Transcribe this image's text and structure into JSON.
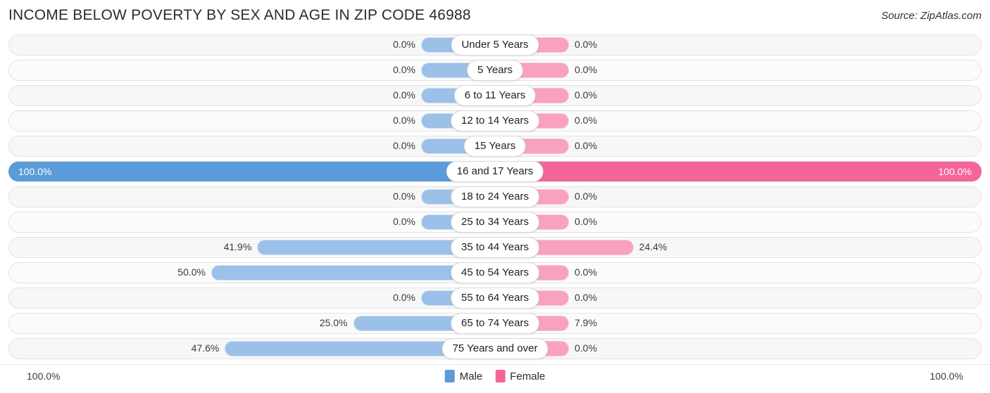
{
  "header": {
    "title": "INCOME BELOW POVERTY BY SEX AND AGE IN ZIP CODE 46988",
    "source": "Source: ZipAtlas.com"
  },
  "footer": {
    "axis_left": "100.0%",
    "axis_right": "100.0%",
    "legend": [
      {
        "label": "Male",
        "color": "#5b9bd9"
      },
      {
        "label": "Female",
        "color": "#f4659a"
      }
    ]
  },
  "colors": {
    "male_light": "#9cc1e8",
    "female_light": "#f9a1c0",
    "male_strong": "#5b9bd9",
    "female_strong": "#f4659a",
    "track": "#f7f7f7"
  },
  "chart_data": {
    "type": "bar",
    "orientation": "horizontal-diverging",
    "title": "INCOME BELOW POVERTY BY SEX AND AGE IN ZIP CODE 46988",
    "xlabel": "",
    "ylabel": "",
    "xlim": [
      0,
      100
    ],
    "units": "%",
    "grid": false,
    "legend_position": "bottom-center",
    "categories": [
      "Under 5 Years",
      "5 Years",
      "6 to 11 Years",
      "12 to 14 Years",
      "15 Years",
      "16 and 17 Years",
      "18 to 24 Years",
      "25 to 34 Years",
      "35 to 44 Years",
      "45 to 54 Years",
      "55 to 64 Years",
      "65 to 74 Years",
      "75 Years and over"
    ],
    "series": [
      {
        "name": "Male",
        "color": "#5b9bd9",
        "values": [
          0.0,
          0.0,
          0.0,
          0.0,
          0.0,
          100.0,
          0.0,
          0.0,
          41.9,
          50.0,
          0.0,
          25.0,
          47.6
        ],
        "labels": [
          "0.0%",
          "0.0%",
          "0.0%",
          "0.0%",
          "0.0%",
          "100.0%",
          "0.0%",
          "0.0%",
          "41.9%",
          "50.0%",
          "0.0%",
          "25.0%",
          "47.6%"
        ]
      },
      {
        "name": "Female",
        "color": "#f4659a",
        "values": [
          0.0,
          0.0,
          0.0,
          0.0,
          0.0,
          100.0,
          0.0,
          0.0,
          24.4,
          0.0,
          0.0,
          7.9,
          0.0
        ],
        "labels": [
          "0.0%",
          "0.0%",
          "0.0%",
          "0.0%",
          "0.0%",
          "100.0%",
          "0.0%",
          "0.0%",
          "24.4%",
          "0.0%",
          "0.0%",
          "7.9%",
          "0.0%"
        ]
      }
    ]
  }
}
